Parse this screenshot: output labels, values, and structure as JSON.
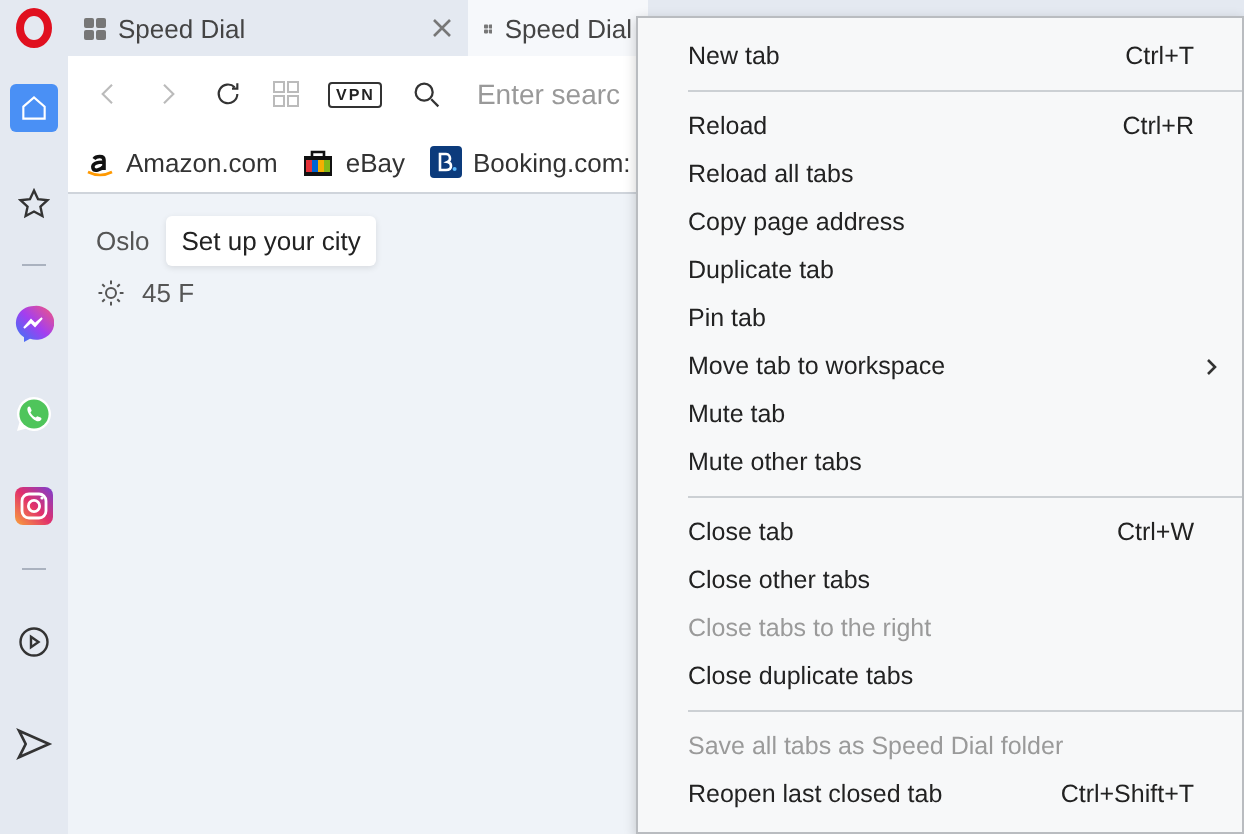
{
  "sidebar": {
    "items": [
      {
        "kind": "logo"
      },
      {
        "kind": "home",
        "selected": true
      },
      {
        "kind": "star",
        "selected": false
      },
      {
        "kind": "divider"
      },
      {
        "kind": "messenger",
        "selected": false
      },
      {
        "kind": "whatsapp",
        "selected": false
      },
      {
        "kind": "instagram",
        "selected": false
      },
      {
        "kind": "divider"
      },
      {
        "kind": "player",
        "selected": false
      },
      {
        "kind": "send",
        "selected": false
      }
    ]
  },
  "tabs": [
    {
      "label": "Speed Dial",
      "selected": false,
      "closable": true
    },
    {
      "label": "Speed Dial",
      "selected": true,
      "closable": false
    }
  ],
  "toolbar": {
    "vpn_label": "VPN",
    "search": {
      "placeholder": "Enter searc"
    }
  },
  "bookmarks": [
    {
      "label": "Amazon.com",
      "kind": "amazon"
    },
    {
      "label": "eBay",
      "kind": "ebay"
    },
    {
      "label": "Booking.com:",
      "kind": "booking"
    }
  ],
  "weather": {
    "city": "Oslo",
    "tooltip": "Set up your city",
    "temperature": "45 F"
  },
  "context_menu": {
    "sections": [
      [
        {
          "label": "New tab",
          "shortcut": "Ctrl+T",
          "disabled": false,
          "submenu": false
        }
      ],
      [
        {
          "label": "Reload",
          "shortcut": "Ctrl+R",
          "disabled": false,
          "submenu": false
        },
        {
          "label": "Reload all tabs",
          "disabled": false,
          "submenu": false
        },
        {
          "label": "Copy page address",
          "disabled": false,
          "submenu": false
        },
        {
          "label": "Duplicate tab",
          "disabled": false,
          "submenu": false
        },
        {
          "label": "Pin tab",
          "disabled": false,
          "submenu": false
        },
        {
          "label": "Move tab to workspace",
          "disabled": false,
          "submenu": true
        },
        {
          "label": "Mute tab",
          "disabled": false,
          "submenu": false
        },
        {
          "label": "Mute other tabs",
          "disabled": false,
          "submenu": false
        }
      ],
      [
        {
          "label": "Close tab",
          "shortcut": "Ctrl+W",
          "disabled": false,
          "submenu": false
        },
        {
          "label": "Close other tabs",
          "disabled": false,
          "submenu": false
        },
        {
          "label": "Close tabs to the right",
          "disabled": true,
          "submenu": false
        },
        {
          "label": "Close duplicate tabs",
          "disabled": false,
          "submenu": false
        }
      ],
      [
        {
          "label": "Save all tabs as Speed Dial folder",
          "disabled": true,
          "submenu": false
        },
        {
          "label": "Reopen last closed tab",
          "shortcut": "Ctrl+Shift+T",
          "disabled": false,
          "submenu": false
        }
      ]
    ]
  }
}
